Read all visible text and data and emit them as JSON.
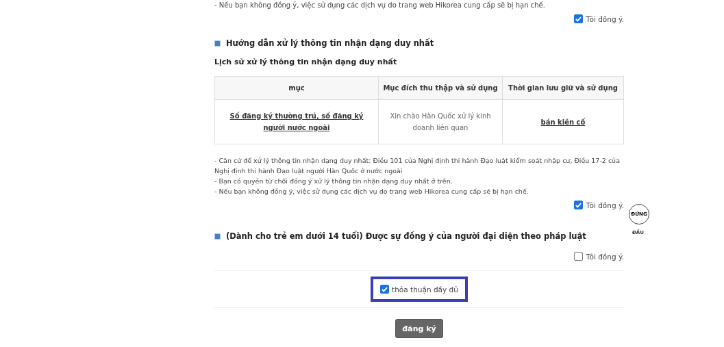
{
  "top_note": "- Nếu bạn không đồng ý, việc sử dụng các dịch vụ do trang web Hikorea cung cấp sẽ bị hạn chế.",
  "top_agree": {
    "label": "Tôi đồng ý.",
    "checked": true
  },
  "section1": {
    "heading": "Hướng dẫn xử lý thông tin nhận dạng duy nhất",
    "subheading": "Lịch sử xử lý thông tin nhận dạng duy nhất",
    "table": {
      "columns": [
        "mục",
        "Mục đích thu thập và sử dụng",
        "Thời gian lưu giữ và sử dụng"
      ],
      "rows": [
        [
          "Số đăng ký thường trú, số đăng ký người nước ngoài",
          "Xin chào Hàn Quốc xử lý kinh doanh liên quan",
          "bán kiên cố"
        ]
      ]
    },
    "notes": [
      "- Căn cứ để xử lý thông tin nhận dạng duy nhất: Điều 101 của Nghị định thi hành Đạo luật kiểm soát nhập cư, Điều 17-2 của Nghị định thi hành Đạo luật người Hàn Quốc ở nước ngoài",
      "- Bạn có quyền từ chối đồng ý xử lý thông tin nhận dạng duy nhất ở trên.",
      "- Nếu bạn không đồng ý, việc sử dụng các dịch vụ do trang web Hikorea cung cấp sẽ bị hạn chế."
    ],
    "agree": {
      "label": "Tôi đồng ý.",
      "checked": true
    }
  },
  "section2": {
    "heading": "(Dành cho trẻ em dưới 14 tuổi) Được sự đồng ý của người đại diện theo pháp luật",
    "agree": {
      "label": "Tôi đồng ý.",
      "checked": false
    }
  },
  "full_agree": {
    "label": "thỏa thuận đầy đủ",
    "checked": true
  },
  "register_button": "đăng ký",
  "top_button": {
    "label": "ĐỨNG",
    "caption": "ĐẦU"
  }
}
